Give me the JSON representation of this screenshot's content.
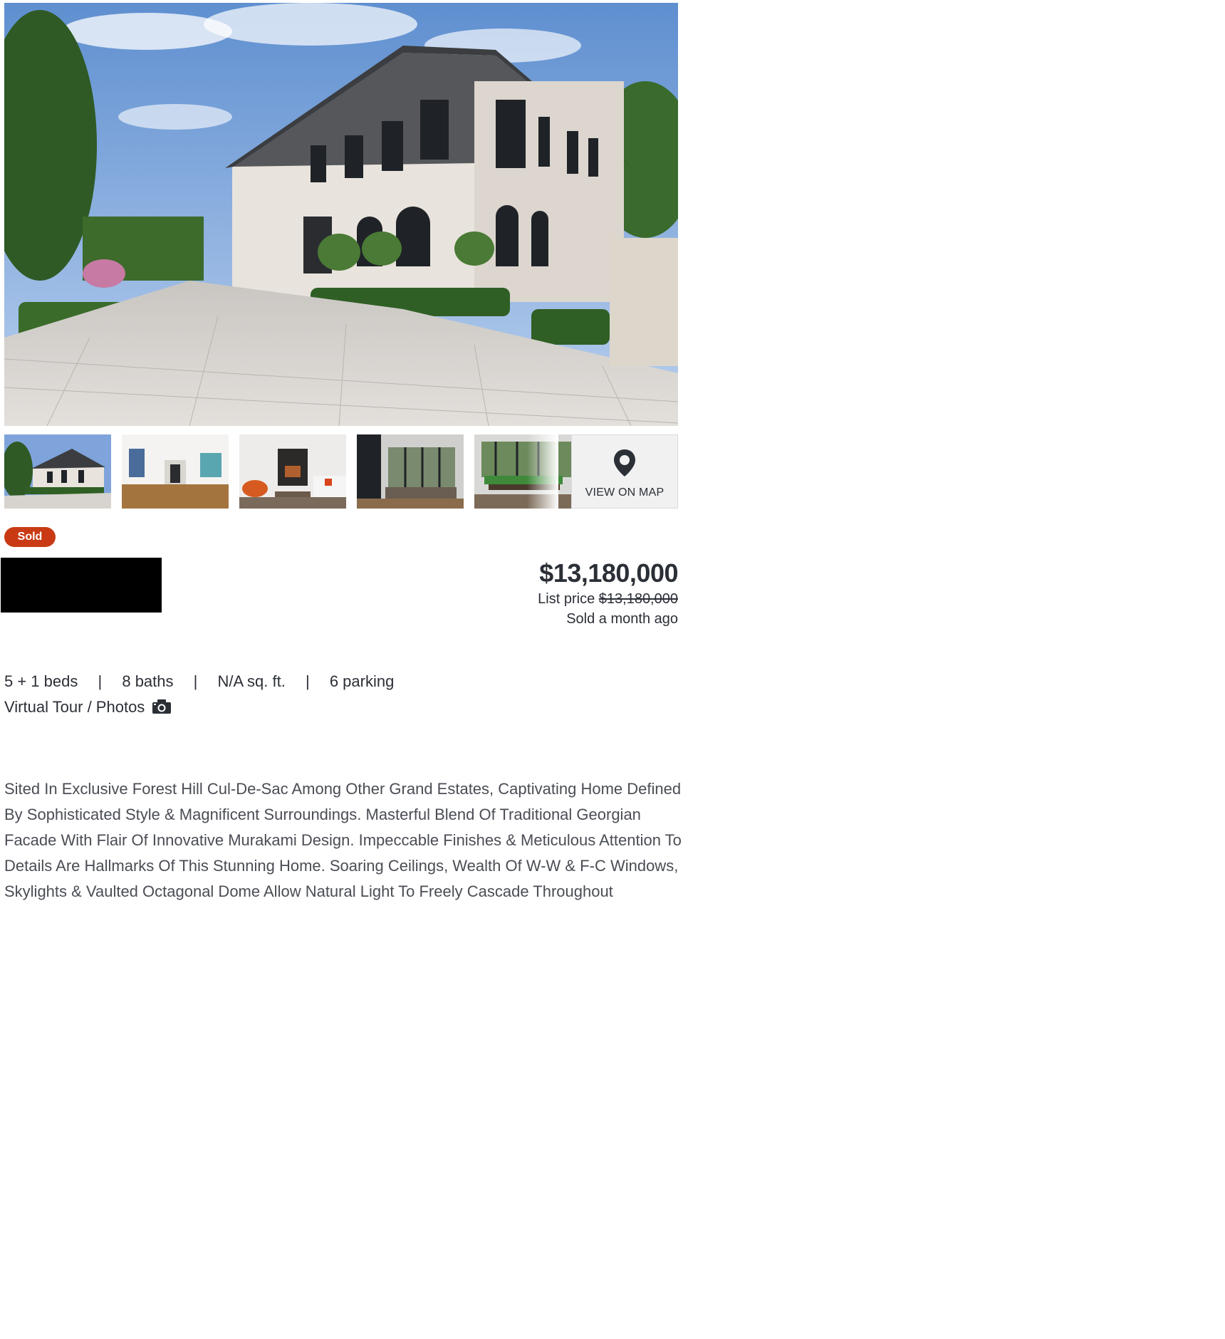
{
  "listing": {
    "status": "Sold",
    "price": "$13,180,000",
    "list_price_label": "List price",
    "list_price_value": "$13,180,000",
    "sold_time": "Sold a month ago"
  },
  "gallery": {
    "map_button_label": "VIEW ON MAP",
    "thumbnails": [
      "exterior",
      "entry-hall",
      "living-room",
      "family-room",
      "dining-room"
    ]
  },
  "specs": {
    "beds": "5 + 1 beds",
    "baths": "8 baths",
    "sqft": "N/A sq. ft.",
    "parking": "6 parking",
    "separator": "|"
  },
  "tour_link": "Virtual Tour / Photos",
  "description": "Sited In Exclusive Forest Hill Cul-De-Sac Among Other Grand Estates, Captivating Home Defined By Sophisticated Style & Magnificent Surroundings. Masterful Blend Of Traditional Georgian Facade With Flair Of Innovative Murakami Design. Impeccable Finishes & Meticulous Attention To Details Are Hallmarks Of This Stunning Home. Soaring Ceilings, Wealth Of W-W & F-C Windows, Skylights & Vaulted Octagonal Dome Allow Natural Light To Freely Cascade Throughout",
  "icons": {
    "map_pin": "map-pin-icon",
    "camera": "camera-icon"
  },
  "colors": {
    "sold_badge": "#c93a14",
    "text": "#2b2f36",
    "description_text": "#4a4d54"
  }
}
